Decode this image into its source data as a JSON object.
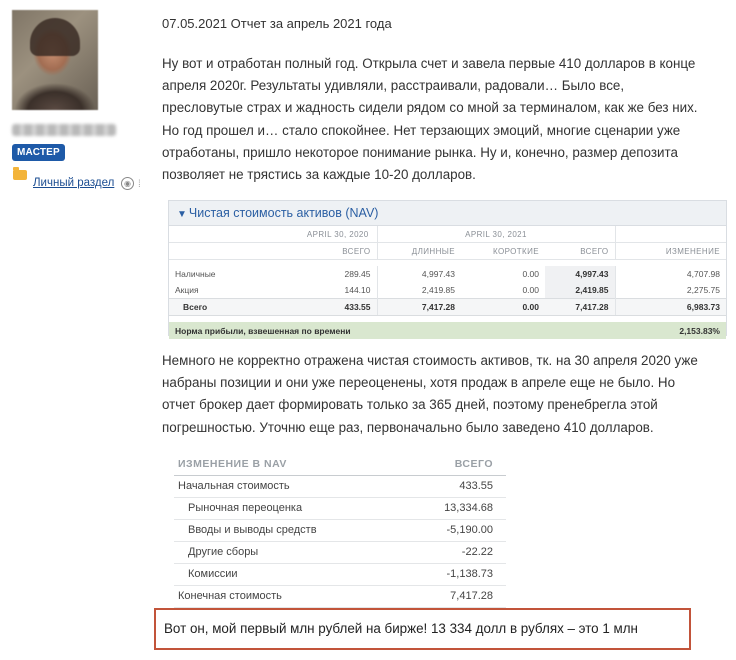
{
  "user": {
    "badge": "МАСТЕР",
    "section_link": "Личный раздел"
  },
  "post": {
    "title": "07.05.2021 Отчет за апрель 2021 года",
    "p1": [
      "Ну вот и отработан полный год. Открыла счет и завела первые 410 долларов в конце",
      "апреля 2020г. Результаты удивляли, расстраивали, радовали… Было все,",
      "пресловутые страх и жадность сидели рядом со мной за терминалом, как же без них.",
      "Но год прошел и… стало спокойнее. Нет терзающих эмоций, многие сценарии уже",
      "отработаны, пришло некоторое понимание рынка. Ну и, конечно, размер депозита",
      "позволяет не трястись за каждые 10-20 долларов."
    ],
    "p2": [
      "Немного не корректно отражена чистая стоимость активов, тк. на 30 апреля 2020 уже",
      "набраны позиции и они уже переоценены, хотя продаж в апреле еще не было. Но",
      "отчет брокер дает формировать только за 365 дней, поэтому пренебрегла этой",
      "погрешностью. Уточню еще раз, первоначально было заведено 410 долларов."
    ],
    "note": "Вот он, мой первый млн рублей на бирже! 13 334 долл в рублях – это 1 млн"
  },
  "nav_table": {
    "header": "Чистая стоимость активов (NAV)",
    "group1": "APRIL 30, 2020",
    "group2": "APRIL 30, 2021",
    "columns": [
      "ВСЕГО",
      "ДЛИННЫЕ",
      "КОРОТКИЕ",
      "ВСЕГО",
      "ИЗМЕНЕНИЕ"
    ],
    "rows": [
      {
        "label": "Наличные",
        "values": [
          "289.45",
          "4,997.43",
          "0.00",
          "4,997.43",
          "4,707.98"
        ]
      },
      {
        "label": "Акция",
        "values": [
          "144.10",
          "2,419.85",
          "0.00",
          "2,419.85",
          "2,275.75"
        ]
      },
      {
        "label": "Всего",
        "values": [
          "433.55",
          "7,417.28",
          "0.00",
          "7,417.28",
          "6,983.73"
        ]
      }
    ],
    "roi_label": "Норма прибыли, взвешенная по времени",
    "roi_value": "2,153.83%"
  },
  "change_table": {
    "header_label": "ИЗМЕНЕНИЕ В NAV",
    "header_value": "ВСЕГО",
    "rows": [
      {
        "label": "Начальная стоимость",
        "value": "433.55"
      },
      {
        "label": "Рыночная переоценка",
        "value": "13,334.68"
      },
      {
        "label": "Вводы и выводы средств",
        "value": "-5,190.00"
      },
      {
        "label": "Другие сборы",
        "value": "-22.22"
      },
      {
        "label": "Комиссии",
        "value": "-1,138.73"
      },
      {
        "label": "Конечная стоимость",
        "value": "7,417.28"
      }
    ]
  }
}
